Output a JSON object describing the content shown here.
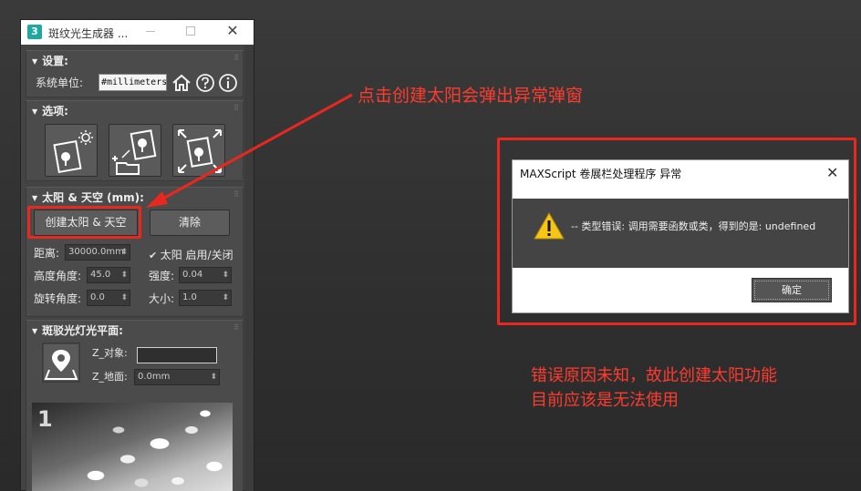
{
  "window": {
    "title": "斑纹光生成器 ...",
    "app_icon_label": "3",
    "sections": {
      "settings": {
        "title": "设置:",
        "units_label": "系统单位:",
        "units_value": "#millimeters",
        "icons": [
          "home-icon",
          "help-icon",
          "info-icon"
        ]
      },
      "options": {
        "title": "选项:",
        "icons": [
          "sun-image-icon",
          "image-folder-icon",
          "expand-image-icon"
        ]
      },
      "sun_sky": {
        "title": "太阳 & 天空 (mm):",
        "create_button": "创建太阳 & 天空",
        "clear_button": "清除",
        "distance_label": "距离:",
        "distance_value": "30000.0mm",
        "sun_toggle_label": "太阳 启用/关闭",
        "sun_toggle_checked": true,
        "altitude_label": "高度角度:",
        "altitude_value": "45.0",
        "intensity_label": "强度:",
        "intensity_value": "0.04",
        "rotation_label": "旋转角度:",
        "rotation_value": "0.0",
        "size_label": "大小:",
        "size_value": "1.0"
      },
      "gobo_plane": {
        "title": "斑驳光灯光平面:",
        "z_object_label": "Z_对象:",
        "z_object_value": "",
        "z_ground_label": "Z_地面:",
        "z_ground_value": "0.0mm",
        "preview_number": "1"
      }
    }
  },
  "annotations": {
    "top": "点击创建太阳会弹出异常弹窗",
    "bottom_line1": "错误原因未知，故此创建太阳功能",
    "bottom_line2": "目前应该是无法使用",
    "color": "#ff3b2f"
  },
  "dialog": {
    "title": "MAXScript 卷展栏处理程序 异常",
    "message": "-- 类型错误: 调用需要函数或类，得到的是: undefined",
    "ok_button": "确定"
  }
}
